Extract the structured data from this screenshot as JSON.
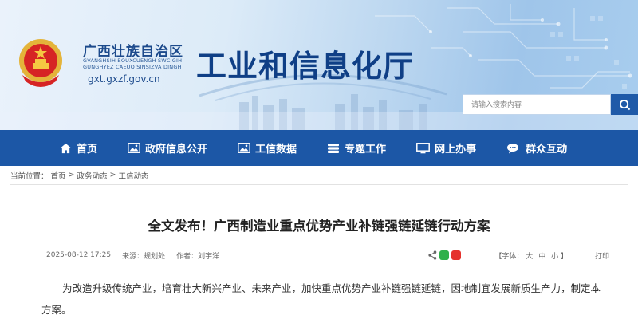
{
  "header": {
    "region_name": "广西壮族自治区",
    "region_latin_line1": "GVANGHSIH BOUXCUENGH SWCIGIH",
    "region_latin_line2": "GUNGHYEZ CAEUQ SINSIZVA DINGH",
    "domain": "gxt.gxzf.gov.cn",
    "department_title": "工业和信息化厅"
  },
  "search": {
    "placeholder": "请输入搜索内容"
  },
  "nav": {
    "items": [
      {
        "label": "首页",
        "icon": "home-icon"
      },
      {
        "label": "政府信息公开",
        "icon": "image-icon"
      },
      {
        "label": "工信数据",
        "icon": "image-icon"
      },
      {
        "label": "专题工作",
        "icon": "stack-icon"
      },
      {
        "label": "网上办事",
        "icon": "monitor-icon"
      },
      {
        "label": "群众互动",
        "icon": "chat-icon"
      }
    ]
  },
  "breadcrumb": {
    "prefix": "当前位置：",
    "items": [
      "首页",
      "政务动态",
      "工信动态"
    ],
    "separator": ">"
  },
  "article": {
    "title": "全文发布！广西制造业重点优势产业补链强链延链行动方案",
    "date": "2025-08-12 17:25",
    "source_label": "来源：",
    "source": "规划处",
    "author_label": "作者：",
    "author": "刘宇洋",
    "font_size_label": "【字体：",
    "font_large": "大",
    "font_medium": "中",
    "font_small": "小",
    "font_size_end": "】",
    "print_label": "打印",
    "paragraph": "为改造升级传统产业，培育壮大新兴产业、未来产业，加快重点优势产业补链强链延链，因地制宜发展新质生产力，制定本方案。"
  },
  "colors": {
    "nav_bg": "#1c57a6",
    "title_blue": "#0f3f86",
    "search_btn": "#1f5aa8"
  }
}
